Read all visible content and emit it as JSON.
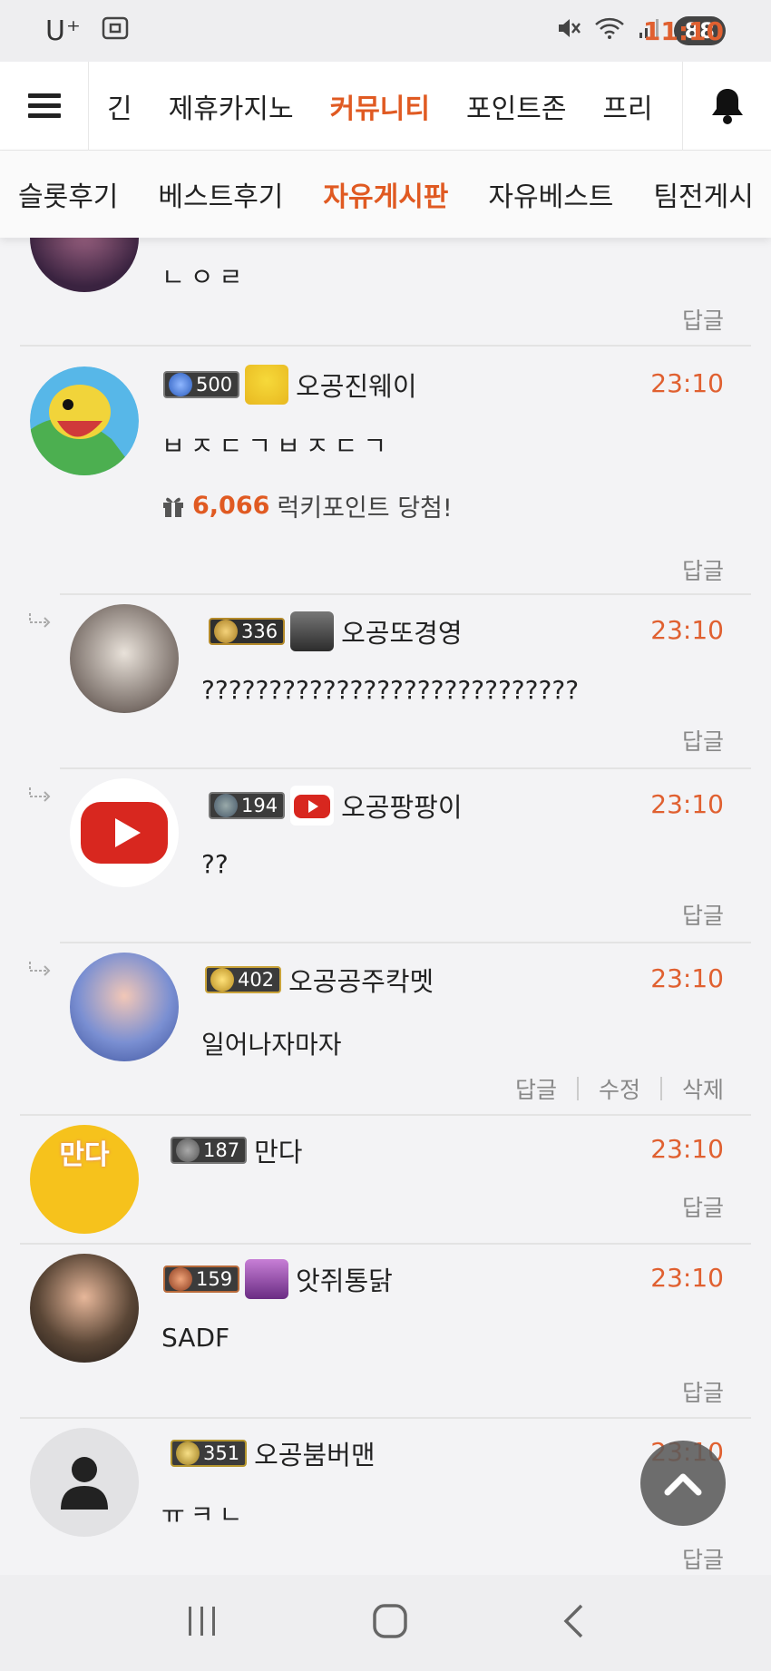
{
  "status_bar": {
    "carrier": "U⁺",
    "time": "11:10",
    "battery": "88"
  },
  "top_nav": {
    "tabs": [
      {
        "label": "긴"
      },
      {
        "label": "제휴카지노"
      },
      {
        "label": "커뮤니티",
        "active": true
      },
      {
        "label": "포인트존"
      },
      {
        "label": "프리"
      }
    ]
  },
  "sub_nav": {
    "tabs": [
      {
        "label": "슬롯후기"
      },
      {
        "label": "베스트후기"
      },
      {
        "label": "자유게시판",
        "active": true
      },
      {
        "label": "자유베스트"
      },
      {
        "label": "팀전게시"
      }
    ]
  },
  "comments": [
    {
      "text": "ㄴㅇㄹ",
      "reply_label": "답글"
    },
    {
      "level": "500",
      "nick": "오공진웨이",
      "time": "23:10",
      "text": "ㅂㅈㄷㄱㅂㅈㄷㄱ",
      "lucky_points": "6,066",
      "lucky_text": "럭키포인트 당첨!",
      "reply_label": "답글"
    },
    {
      "level": "336",
      "nick": "오공또경영",
      "time": "23:10",
      "text": "????????????????????????????",
      "reply_label": "답글"
    },
    {
      "level": "194",
      "nick": "오공팡팡이",
      "time": "23:10",
      "text": "??",
      "reply_label": "답글"
    },
    {
      "level": "402",
      "nick": "오공공주칵멧",
      "time": "23:10",
      "text": "일어나자마자",
      "reply_label": "답글",
      "edit_label": "수정",
      "delete_label": "삭제"
    },
    {
      "level": "187",
      "nick": "만다",
      "time": "23:10",
      "text": "",
      "reply_label": "답글",
      "avatar_text": "만다"
    },
    {
      "level": "159",
      "nick": "앗쥐통닭",
      "time": "23:10",
      "text": "SADF",
      "reply_label": "답글"
    },
    {
      "level": "351",
      "nick": "오공붐버맨",
      "time": "23:10",
      "text": "ㅠㅋㄴ",
      "reply_label": "답글"
    }
  ],
  "colors": {
    "accent": "#e05a22",
    "time": "#e06030"
  },
  "icons": {
    "menu": "hamburger-icon",
    "notification": "bell-icon",
    "scroll_top": "chevron-up-icon",
    "reply_indicator": "reply-arrow-icon",
    "gift": "gift-icon"
  }
}
